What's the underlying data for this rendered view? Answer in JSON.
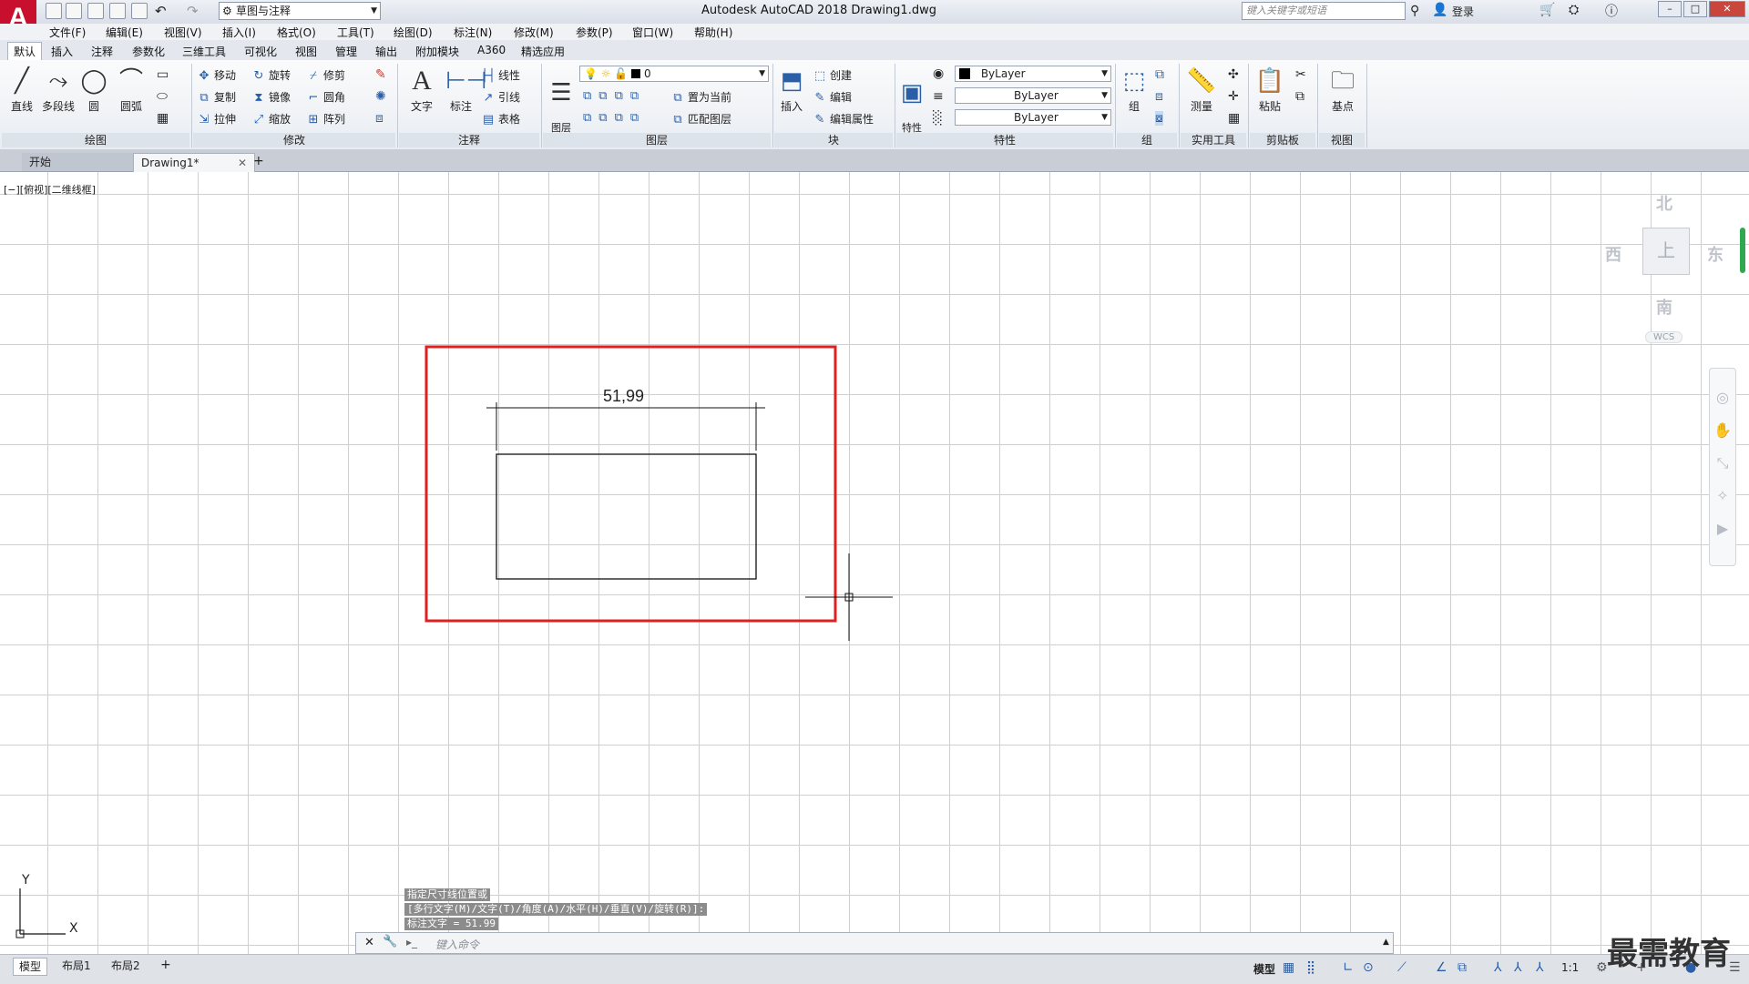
{
  "app": {
    "logo": "A",
    "title": "Autodesk AutoCAD 2018    Drawing1.dwg",
    "workspace": "草图与注释",
    "search_placeholder": "键入关键字或短语",
    "login": "登录"
  },
  "menu": [
    "文件(F)",
    "编辑(E)",
    "视图(V)",
    "插入(I)",
    "格式(O)",
    "工具(T)",
    "绘图(D)",
    "标注(N)",
    "修改(M)",
    "参数(P)",
    "窗口(W)",
    "帮助(H)"
  ],
  "ribbon_tabs": [
    "默认",
    "插入",
    "注释",
    "参数化",
    "三维工具",
    "可视化",
    "视图",
    "管理",
    "输出",
    "附加模块",
    "A360",
    "精选应用"
  ],
  "ribbon": {
    "draw": {
      "title": "绘图",
      "line": "直线",
      "polyline": "多段线",
      "circle": "圆",
      "arc": "圆弧"
    },
    "modify": {
      "title": "修改",
      "move": "移动",
      "rotate": "旋转",
      "trim": "修剪",
      "copy": "复制",
      "mirror": "镜像",
      "fillet": "圆角",
      "stretch": "拉伸",
      "scale": "缩放",
      "array": "阵列"
    },
    "annotation": {
      "title": "注释",
      "text": "文字",
      "dimension": "标注",
      "linear": "线性",
      "leader": "引线",
      "table": "表格"
    },
    "layers": {
      "title": "图层",
      "layer_properties": "图层\n特性",
      "layer_name": "0",
      "set_current": "置为当前",
      "match_layer": "匹配图层"
    },
    "block": {
      "title": "块",
      "insert": "插入",
      "create": "创建",
      "edit": "编辑",
      "edit_attributes": "编辑属性"
    },
    "properties": {
      "title": "特性",
      "match": "特性\n匹配",
      "color": "ByLayer",
      "linetype": "ByLayer",
      "lineweight": "ByLayer"
    },
    "groups": {
      "title": "组",
      "group": "组"
    },
    "utilities": {
      "title": "实用工具",
      "measure": "测量"
    },
    "clipboard": {
      "title": "剪贴板",
      "paste": "粘贴"
    },
    "view": {
      "title": "视图",
      "base": "基点"
    }
  },
  "doc_tabs": {
    "start": "开始",
    "drawing": "Drawing1*"
  },
  "viewport": {
    "label": "[−][俯视][二维线框]",
    "dimension_text": "51,99",
    "viewcube": {
      "north": "北",
      "south": "南",
      "east": "东",
      "west": "西",
      "face": "上",
      "wcs": "WCS"
    },
    "ucs_x": "X",
    "ucs_y": "Y"
  },
  "command": {
    "history": [
      "指定尺寸线位置或",
      "[多行文字(M)/文字(T)/角度(A)/水平(H)/垂直(V)/旋转(R)]:",
      "标注文字 = 51.99"
    ],
    "prompt": "键入命令"
  },
  "layout_tabs": [
    "模型",
    "布局1",
    "布局2"
  ],
  "status": {
    "model": "模型",
    "scale": "1:1"
  },
  "watermark": "最需教育"
}
